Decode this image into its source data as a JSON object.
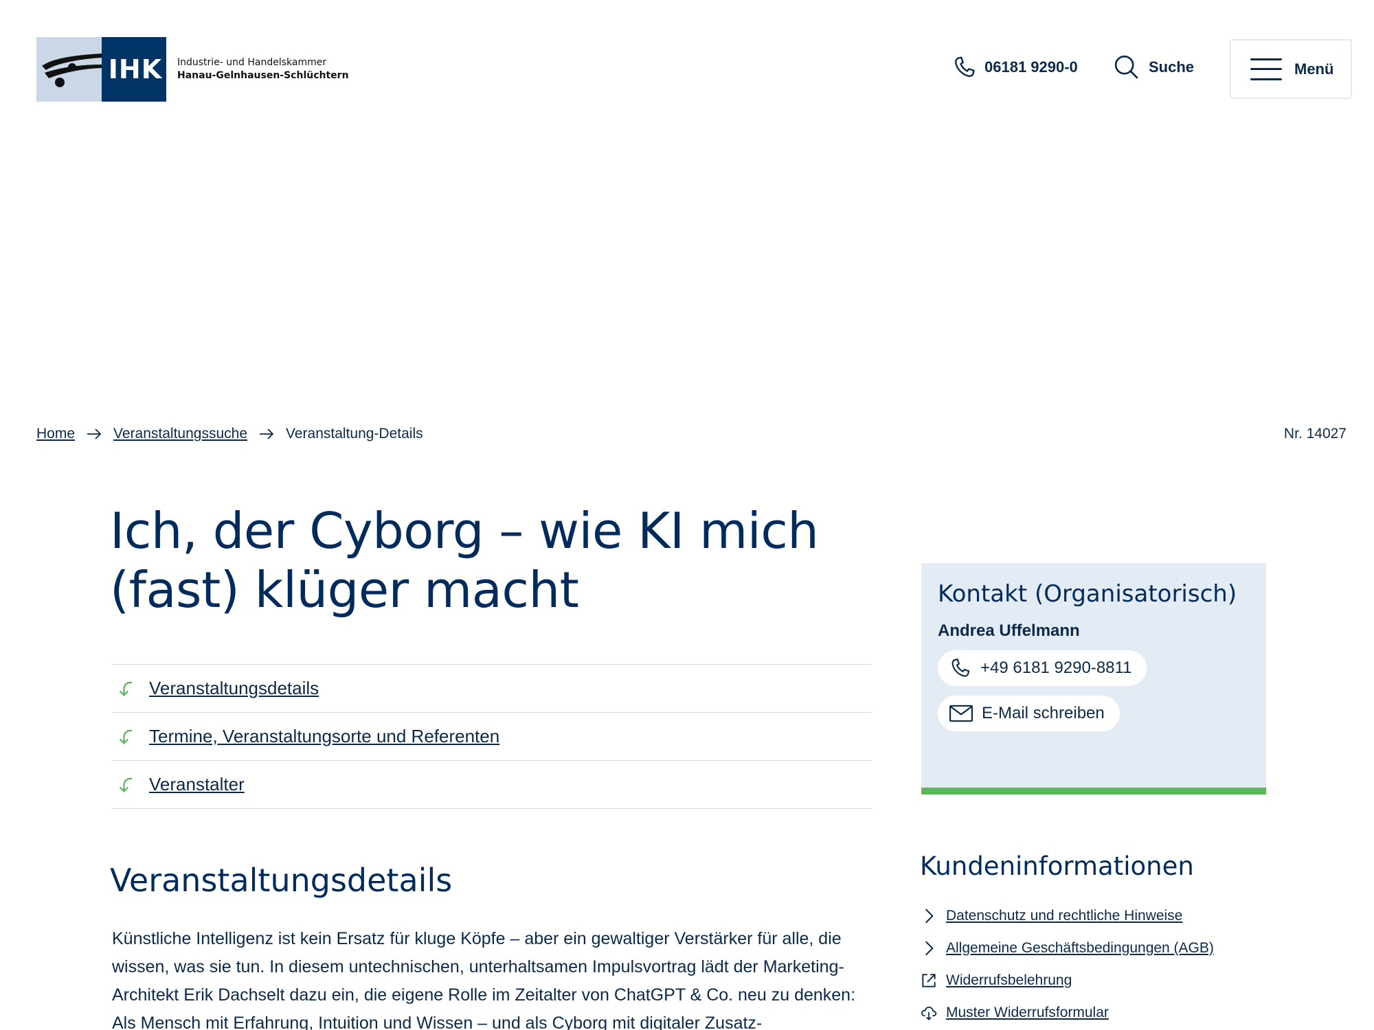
{
  "header": {
    "logo": {
      "abbr": "IHK",
      "line1": "Industrie- und Handelskammer",
      "line2": "Hanau-Gelnhausen-Schlüchtern"
    },
    "phone": "06181 9290-0",
    "search_label": "Suche",
    "menu_label": "Menü"
  },
  "breadcrumb": {
    "items": [
      "Home",
      "Veranstaltungssuche",
      "Veranstaltung-Details"
    ]
  },
  "event_number": "Nr. 14027",
  "main": {
    "title": "Ich, der Cyborg – wie KI mich (fast) klüger macht",
    "toc": [
      "Veranstaltungsdetails",
      "Termine, Veranstaltungsorte und Referenten",
      "Veranstalter"
    ],
    "section_title": "Veranstaltungsdetails",
    "body": "Künstliche Intelligenz ist kein Ersatz für kluge Köpfe – aber ein gewaltiger Verstärker für alle, die wissen, was sie tun. In diesem untechnischen, unterhaltsamen Impulsvortrag lädt der Marketing-Architekt Erik Dachselt dazu ein, die eigene Rolle im Zeitalter von ChatGPT & Co. neu zu denken: Als Mensch mit Erfahrung, Intuition und Wissen – und als Cyborg mit digitaler Zusatz-"
  },
  "contact": {
    "heading": "Kontakt (Organisatorisch)",
    "name": "Andrea Uffelmann",
    "phone": "+49 6181 9290-8811",
    "email_label": "E-Mail schreiben"
  },
  "customer_info": {
    "heading": "Kundeninformationen",
    "links": [
      {
        "label": "Datenschutz und rechtliche Hinweise",
        "icon": "chevron-right-icon"
      },
      {
        "label": "Allgemeine Geschäftsbedingungen (AGB)",
        "icon": "chevron-right-icon"
      },
      {
        "label": "Widerrufsbelehrung",
        "icon": "external-link-icon"
      },
      {
        "label": "Muster Widerrufsformular",
        "icon": "download-cloud-icon"
      }
    ]
  },
  "colors": {
    "primary": "#002b5c",
    "text": "#0b2a4a",
    "card_bg": "#e3ebf4",
    "accent_green": "#5cb85c"
  }
}
